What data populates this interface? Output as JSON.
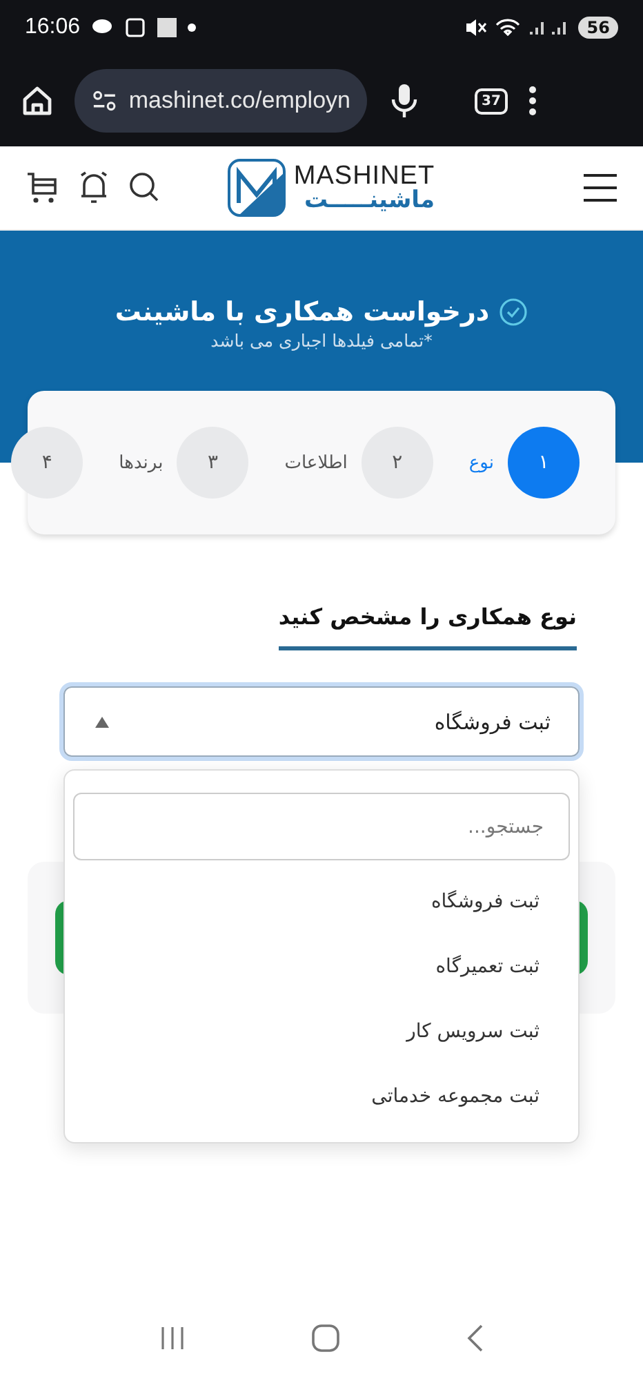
{
  "status_bar": {
    "time": "16:06",
    "battery": "56"
  },
  "browser": {
    "url": "mashinet.co/employn",
    "tab_count": "37"
  },
  "header": {
    "logo_latin": "MASHINET",
    "logo_persian": "ماشینـــــت"
  },
  "banner": {
    "title": "درخواست همکاری با ماشینت",
    "subtitle": "*تمامی فیلدها اجباری می باشد"
  },
  "steps": [
    {
      "number": "۱",
      "label": "نوع",
      "selected": true
    },
    {
      "number": "۲",
      "label": "اطلاعات",
      "selected": false
    },
    {
      "number": "۳",
      "label": "برندها",
      "selected": false
    },
    {
      "number": "۴",
      "selected": false
    }
  ],
  "section": {
    "title": "نوع همکاری را مشخص کنید"
  },
  "select": {
    "value": "ثبت فروشگاه",
    "expanded": true,
    "search_placeholder": "جستجو...",
    "options": [
      {
        "label": "ثبت فروشگاه"
      },
      {
        "label": "ثبت تعمیرگاه"
      },
      {
        "label": "ثبت سرویس کار"
      },
      {
        "label": "ثبت مجموعه خدماتی"
      }
    ]
  }
}
